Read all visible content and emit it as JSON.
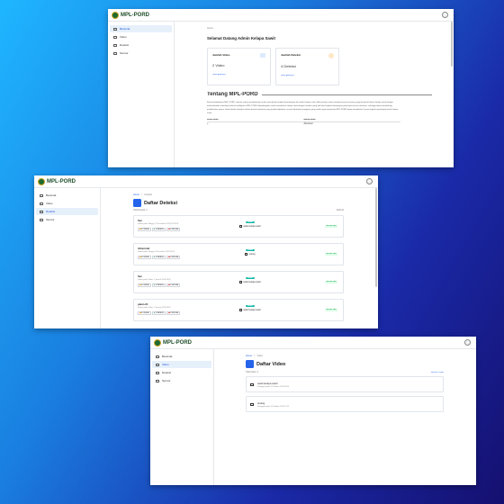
{
  "brand": {
    "name": "MPL-PORD",
    "sub": ""
  },
  "nav": [
    "Beranda",
    "Video",
    "Deteksi",
    "Sensor"
  ],
  "shot1": {
    "breadcrumb": "Home",
    "welcome": "Selamat Datang Admin Kelapa Sawit",
    "cards": [
      {
        "title": "Jumlah Video",
        "value": "2 Video",
        "link": "Selengkapnya",
        "icon": "video-icon"
      },
      {
        "title": "Jumlah Deteksi",
        "value": "4 Deteksi",
        "link": "Selengkapnya",
        "icon": "detection-icon"
      }
    ],
    "about_title": "Tentang MPL-PORD",
    "about_text": "Kami berkolaborasi MPL-PORD, sebuah sistem pendeteksian untuk menentukan tingkat kematangan dari buah kelapa sawit, dikhususkan untuk membantu proses panen yang berada di kebun kelapa sawit dengan memanfaatkan teknologi artificial intelligence MPL-PORD dikembangkan untuk mendeteksi kelapa sawit dengan kualitas yang baik dan tingkat kematangan yang tepat secara otomatis, sehingga dapat mendukung produktivitas panen. Hasil deteksi disajikan dalam bentuk informasi yang mudah dipahami sesuai kebutuhan pengguna yang selalu ingin memantau MPL-PORD dapat mendeteksi 4 jenis tingkat kematangan buah kelapa sawit.",
    "table_headers": [
      "Kode Kelas",
      "Nama Kelas"
    ],
    "table_row": [
      "0",
      "Abnormal"
    ]
  },
  "shot2": {
    "breadcrumb": [
      "Home",
      "Deteksi"
    ],
    "title": "Daftar Deteksi",
    "total": "Total Deteksi: 4",
    "refresh": "Refresh",
    "items": [
      {
        "name": "Sec",
        "meta": "Dibuat pada: Minggu, 15 Desember 2024 13:32:08",
        "tags": [
          "4 DIPAKAI",
          "0 MATANG",
          "2 MENTAH"
        ],
        "badge": "VIDEO",
        "video": "sawit kelapa sawit",
        "status": "DETECTED"
      },
      {
        "name": "Abnormal",
        "meta": "Dibuat pada: Minggu, 8 Desember 2024 16:00",
        "tags": [
          "4 DIPAKAI",
          "0 MATANG",
          "2 MENTAH"
        ],
        "badge": "VIDEO",
        "video": "testing",
        "status": "DETECTED"
      },
      {
        "name": "Sec",
        "meta": "Dibuat pada: Rabu, 1 Januari 2025 08:29",
        "tags": [
          "4 DIPAKAI",
          "0 MATANG",
          "2 MENTAH"
        ],
        "badge": "VIDEO",
        "video": "sawit kelapa sawit",
        "status": "DETECTED"
      },
      {
        "name": "paten-21",
        "meta": "Dibuat pada: Rabu, 1 Januari 2025 08:29",
        "tags": [
          "4 DIPAKAI",
          "0 MATANG",
          "2 MENTAH"
        ],
        "badge": "VIDEO",
        "video": "sawit kelapa sawit",
        "status": "DETECTED"
      }
    ]
  },
  "shot3": {
    "breadcrumb": [
      "Home",
      "Video"
    ],
    "title": "Daftar Video",
    "total": "Total Video: 2",
    "add": "Tambah Video",
    "items": [
      {
        "name": "sawit kelapa sawit",
        "meta": "Diunggah pada: 24 Oktober 2024 18:00"
      },
      {
        "name": "testing",
        "meta": "Diunggah pada: 24 Oktober 2024 17:59"
      }
    ]
  },
  "colors": {
    "accent": "#2563eb",
    "brand": "#1f6b2e",
    "detected": "#16a34a",
    "badge": "#14b8a6"
  }
}
